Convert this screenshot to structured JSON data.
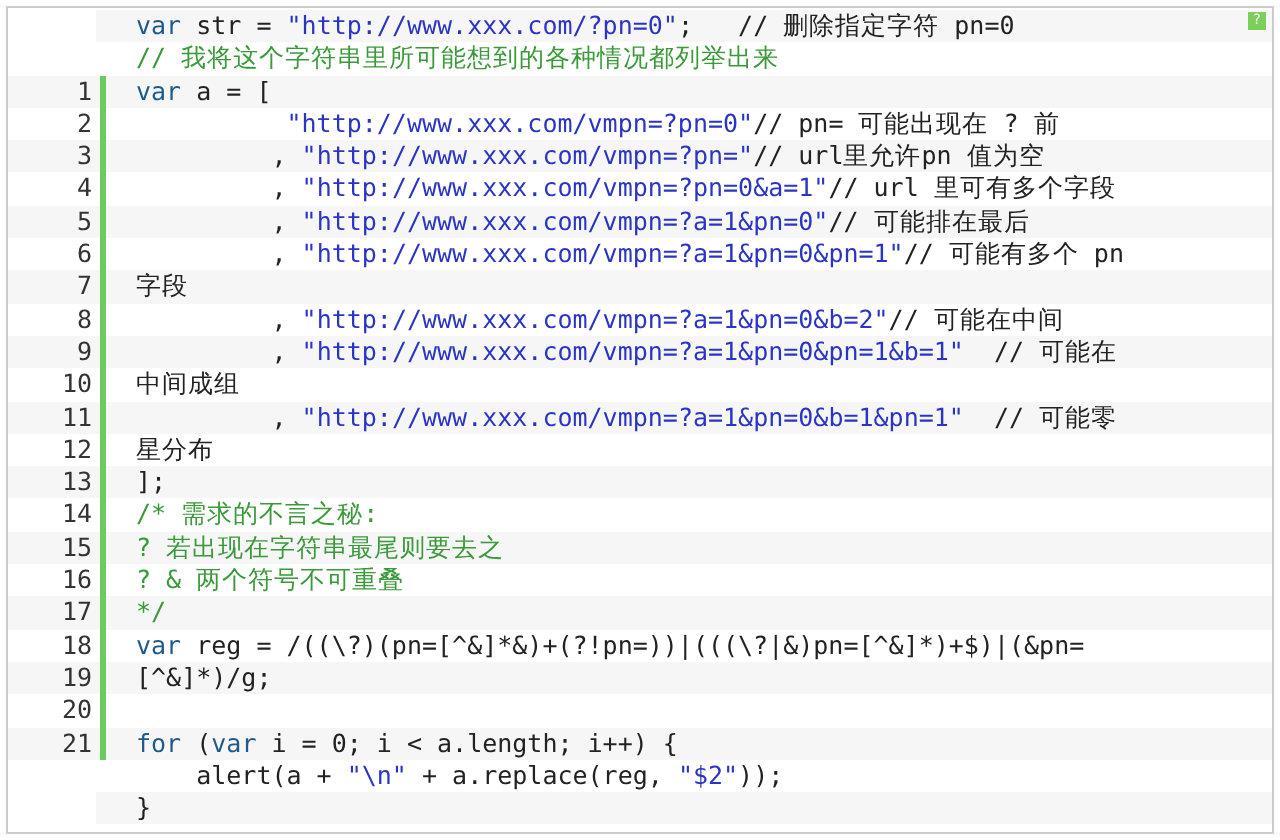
{
  "help_badge": "?",
  "lines": [
    {
      "tokens": [
        {
          "kind": "keyword",
          "text": "var"
        },
        {
          "kind": "plain",
          "text": " str = "
        },
        {
          "kind": "string",
          "text": "\"http://www.xxx.com/?pn=0\""
        },
        {
          "kind": "plain",
          "text": ";   // 删除指定字符 pn=0"
        }
      ]
    },
    {
      "tokens": [
        {
          "kind": "comment",
          "text": "// 我将这个字符串里所可能想到的各种情况都列举出来"
        }
      ]
    },
    {
      "number": "1",
      "tokens": [
        {
          "kind": "keyword",
          "text": "var"
        },
        {
          "kind": "plain",
          "text": " a = ["
        }
      ]
    },
    {
      "number": "2",
      "tokens": [
        {
          "kind": "string",
          "text": "          \"http://www.xxx.com/vmpn=?pn=0\""
        },
        {
          "kind": "plain",
          "text": "// pn= 可能出现在 ? 前"
        }
      ]
    },
    {
      "number": "3",
      "tokens": [
        {
          "kind": "plain",
          "text": "         , "
        },
        {
          "kind": "string",
          "text": "\"http://www.xxx.com/vmpn=?pn=\""
        },
        {
          "kind": "plain",
          "text": "// url里允许pn 值为空"
        }
      ]
    },
    {
      "number": "4",
      "tokens": [
        {
          "kind": "plain",
          "text": "         , "
        },
        {
          "kind": "string",
          "text": "\"http://www.xxx.com/vmpn=?pn=0&a=1\""
        },
        {
          "kind": "plain",
          "text": "// url 里可有多个字段"
        }
      ]
    },
    {
      "number": "5",
      "tokens": [
        {
          "kind": "plain",
          "text": "         , "
        },
        {
          "kind": "string",
          "text": "\"http://www.xxx.com/vmpn=?a=1&pn=0\""
        },
        {
          "kind": "plain",
          "text": "// 可能排在最后"
        }
      ]
    },
    {
      "number": "6",
      "tokens": [
        {
          "kind": "plain",
          "text": "         , "
        },
        {
          "kind": "string",
          "text": "\"http://www.xxx.com/vmpn=?a=1&pn=0&pn=1\""
        },
        {
          "kind": "plain",
          "text": "// 可能有多个 pn"
        }
      ]
    },
    {
      "number": "7",
      "tokens": [
        {
          "kind": "plain",
          "text": "字段"
        }
      ]
    },
    {
      "number": "8",
      "tokens": [
        {
          "kind": "plain",
          "text": "         , "
        },
        {
          "kind": "string",
          "text": "\"http://www.xxx.com/vmpn=?a=1&pn=0&b=2\""
        },
        {
          "kind": "plain",
          "text": "// 可能在中间"
        }
      ]
    },
    {
      "number": "9",
      "tokens": [
        {
          "kind": "plain",
          "text": "         , "
        },
        {
          "kind": "string",
          "text": "\"http://www.xxx.com/vmpn=?a=1&pn=0&pn=1&b=1\""
        },
        {
          "kind": "plain",
          "text": "  // 可能在"
        }
      ]
    },
    {
      "number": "10",
      "tokens": [
        {
          "kind": "plain",
          "text": "中间成组"
        }
      ]
    },
    {
      "number": "11",
      "tokens": [
        {
          "kind": "plain",
          "text": "         , "
        },
        {
          "kind": "string",
          "text": "\"http://www.xxx.com/vmpn=?a=1&pn=0&b=1&pn=1\""
        },
        {
          "kind": "plain",
          "text": "  // 可能零"
        }
      ]
    },
    {
      "number": "12",
      "tokens": [
        {
          "kind": "plain",
          "text": "星分布"
        }
      ]
    },
    {
      "number": "13",
      "tokens": [
        {
          "kind": "plain",
          "text": "];"
        }
      ]
    },
    {
      "number": "14",
      "tokens": [
        {
          "kind": "comment",
          "text": "/* 需求的不言之秘:"
        }
      ]
    },
    {
      "number": "15",
      "tokens": [
        {
          "kind": "comment",
          "text": "? 若出现在字符串最尾则要去之"
        }
      ]
    },
    {
      "number": "16",
      "tokens": [
        {
          "kind": "comment",
          "text": "? & 两个符号不可重叠"
        }
      ]
    },
    {
      "number": "17",
      "tokens": [
        {
          "kind": "comment",
          "text": "*/"
        }
      ]
    },
    {
      "number": "18",
      "tokens": [
        {
          "kind": "keyword",
          "text": "var"
        },
        {
          "kind": "plain",
          "text": " reg = /((\\?)(pn=[^&]*&)+(?!pn=))|(((\\?|&)pn=[^&]*)+$)|(&pn="
        }
      ]
    },
    {
      "number": "19",
      "tokens": [
        {
          "kind": "plain",
          "text": "[^&]*)/g;"
        }
      ]
    },
    {
      "number": "20"
    },
    {
      "number": "21",
      "tokens": [
        {
          "kind": "keyword",
          "text": "for"
        },
        {
          "kind": "plain",
          "text": " ("
        },
        {
          "kind": "keyword",
          "text": "var"
        },
        {
          "kind": "plain",
          "text": " i = 0; i < a.length; i++) {"
        }
      ]
    },
    {
      "tokens": [
        {
          "kind": "plain",
          "text": "    alert(a + "
        },
        {
          "kind": "string",
          "text": "\"\\n\""
        },
        {
          "kind": "plain",
          "text": " + a.replace(reg, "
        },
        {
          "kind": "string",
          "text": "\"$2\""
        },
        {
          "kind": "plain",
          "text": "));"
        }
      ]
    },
    {
      "tokens": [
        {
          "kind": "plain",
          "text": "}"
        }
      ]
    }
  ]
}
